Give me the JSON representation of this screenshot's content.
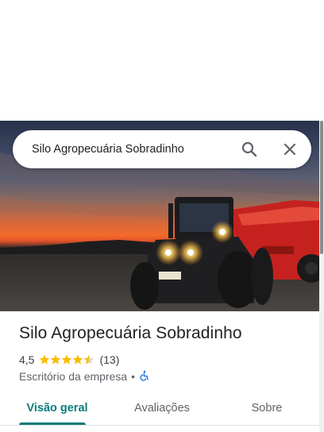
{
  "search": {
    "query": "Silo Agropecuária Sobradinho",
    "search_icon": "search-icon",
    "close_icon": "close-icon"
  },
  "hero": {
    "image_subject": "tractor-and-trailer-at-sunset",
    "accent_color": "#e8402a"
  },
  "place": {
    "title": "Silo Agropecuária Sobradinho",
    "rating": "4,5",
    "rating_value": 4.5,
    "review_count": "(13)",
    "category": "Escritório da empresa",
    "separator": "•",
    "accessibility_icon": "wheelchair-icon",
    "star_color": "#fbbc04",
    "accessibility_color": "#1a73e8"
  },
  "tabs": [
    {
      "label": "Visão geral",
      "active": true
    },
    {
      "label": "Avaliações",
      "active": false
    },
    {
      "label": "Sobre",
      "active": false
    }
  ],
  "colors": {
    "active_tab": "#0b7b7b",
    "inactive_tab": "#5f6368"
  }
}
